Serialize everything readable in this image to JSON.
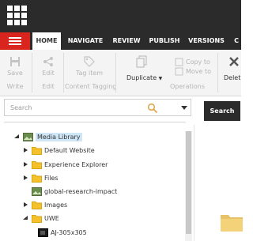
{
  "ribbon_tabs": [
    "HOME",
    "NAVIGATE",
    "REVIEW",
    "PUBLISH",
    "VERSIONS",
    "C"
  ],
  "ribbon": {
    "save": "Save",
    "write": "Write",
    "edit_top": "Edit",
    "edit_bottom": "Edit",
    "tag_item": "Tag item",
    "content_tagging": "Content Tagging",
    "duplicate": "Duplicate",
    "copy_to": "Copy to",
    "move_to": "Move to",
    "operations": "Operations",
    "delete": "Delet"
  },
  "search": {
    "placeholder": "Search",
    "button": "Search"
  },
  "tree": {
    "root": "Media Library",
    "items": [
      "Default Website",
      "Experience Explorer",
      "Files",
      "global-research-impact",
      "Images",
      "UWE",
      "AJ-305x305"
    ]
  },
  "colors": {
    "header": "#2b2b2b",
    "accent_red": "#d9251d",
    "folder": "#f4c12a",
    "selected": "#cfe6f7"
  },
  "icons": [
    "logo-grid-icon",
    "hamburger-icon",
    "save-icon",
    "share-icon",
    "tag-icon",
    "duplicate-icon",
    "copy-icon",
    "move-icon",
    "delete-icon",
    "search-icon",
    "chevron-down-icon",
    "folder-icon",
    "image-icon"
  ]
}
